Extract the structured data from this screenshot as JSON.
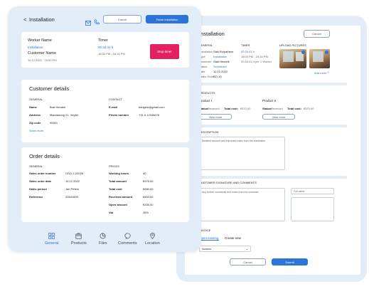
{
  "front": {
    "header": {
      "back_glyph": "<",
      "title": "Installation",
      "cancel": "Cancel",
      "finish": "Finish installation"
    },
    "worker": {
      "worker_label": "Worker Name",
      "worker_value": "Installation",
      "customer_label": "Customer Name",
      "date": "10.12.2022 · 16:00 PM",
      "timer_label": "Timer",
      "timer_value": "00:34:41 h",
      "timer_range": "18:00 PM - 18:34 PM",
      "stop_timer": "Stop timer"
    },
    "customer": {
      "title": "Customer details",
      "general_label": "GENERAL",
      "contact_label": "CONTACT",
      "name_label": "Name",
      "name_value": "Brat Hendrik",
      "address_label": "Address",
      "address_value": "Marxlanung 21, Vegtel",
      "zip_label": "Zip code",
      "zip_value": "90001",
      "show_more": "Show more",
      "email_label": "E-mail",
      "email_value": "bangele@gmail.com",
      "phone_label": "Phone number",
      "phone_value": "+31 6 12345678"
    },
    "order": {
      "title": "Order details",
      "general_label": "GENERAL",
      "prices_label": "PRICES",
      "rows_left": [
        {
          "label": "Sales order number",
          "value": "OSO-1-22028"
        },
        {
          "label": "Sales order date",
          "value": "15.12.2022"
        },
        {
          "label": "Sales person",
          "value": "Jan Peters"
        },
        {
          "label": "Reference",
          "value": "23541690"
        }
      ],
      "rows_right": [
        {
          "label": "Working hours",
          "value": "40"
        },
        {
          "label": "Total amount",
          "value": "€975,00"
        },
        {
          "label": "Total cost",
          "value": "€680,00"
        },
        {
          "label": "Received amount",
          "value": "€600,00"
        },
        {
          "label": "Open amount",
          "value": "€335,00"
        },
        {
          "label": "Vat",
          "value": "45%"
        }
      ]
    },
    "nav": {
      "general": "General",
      "products": "Products",
      "files": "Files",
      "comments": "Comments",
      "location": "Location"
    }
  },
  "back": {
    "title": "Installation",
    "cancel": "Cancel",
    "general_label": "GENERAL",
    "general_rows": [
      {
        "label": "Installation",
        "value": "Stall Roipathers"
      },
      {
        "label": "Type",
        "value": "Installation"
      },
      {
        "label": "Customer",
        "value": "Stall Hendrik"
      },
      {
        "label": "Status",
        "value": "Scheduled"
      },
      {
        "label": "Date",
        "value": "10.12.2022"
      },
      {
        "label": "Sales Order",
        "value": "SO-10"
      }
    ],
    "timer_label": "TIMER",
    "timer_value": "00:34:41 h",
    "timer_range": "18:00 PM - 18:34 PM",
    "timer_extra": "00:34:41 h per 1 Worker",
    "upload_label": "UPLOAD PICTURES",
    "add_more": "Add more",
    "products_label": "PRODUCTS",
    "products": [
      {
        "name": "Product I",
        "status_label": "Status:",
        "status_value": "Received",
        "cost_label": "Total cost:",
        "cost_value": "€570,00",
        "view_more": "View more"
      },
      {
        "name": "Product II",
        "status_label": "Status:",
        "status_value": "Received",
        "cost_label": "Total cost:",
        "cost_value": "€570,00",
        "view_more": "View more"
      }
    ],
    "description_label": "DESCRIPTION",
    "description_placeholder": "Detailed account and important notes from the installation",
    "signature_label": "CUSTOMER SIGNATURE AND COMMENTS",
    "signature_placeholder": "Any further comments and notes from the customer",
    "fullname_placeholder": "Full name",
    "invoice_label": "INVOICE",
    "invoice_tab_active": "Open existing",
    "invoice_tab": "Create new",
    "invoice_select": "Invoices",
    "cancel_bottom": "Cancel",
    "submit": "Submit"
  }
}
